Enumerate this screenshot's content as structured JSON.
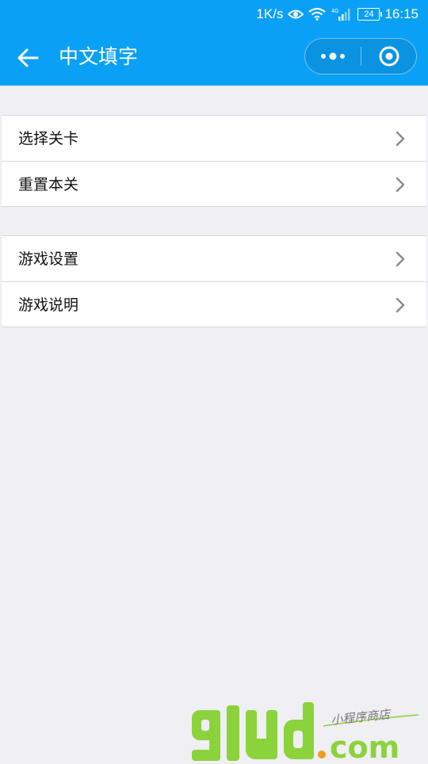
{
  "status_bar": {
    "net_speed": "1K/s",
    "network_type": "4G",
    "battery": "24",
    "time": "16:15",
    "icons": [
      "eye-icon",
      "wifi-icon",
      "signal-icon",
      "battery-icon"
    ]
  },
  "navbar": {
    "title": "中文填字",
    "back_icon": "arrow-left-icon",
    "capsule": {
      "more_icon": "more-dots-icon",
      "close_icon": "target-circle-icon"
    }
  },
  "menu": {
    "group1": [
      {
        "label": "选择关卡"
      },
      {
        "label": "重置本关"
      }
    ],
    "group2": [
      {
        "label": "游戏设置"
      },
      {
        "label": "游戏说明"
      }
    ]
  },
  "watermark": {
    "logo": "91ud.com",
    "tagline": "小程序商店"
  },
  "colors": {
    "brand": "#0aa0f5",
    "background": "#efeff4",
    "watermark_green": "#8bd33a",
    "watermark_orange": "#f39a1b"
  }
}
